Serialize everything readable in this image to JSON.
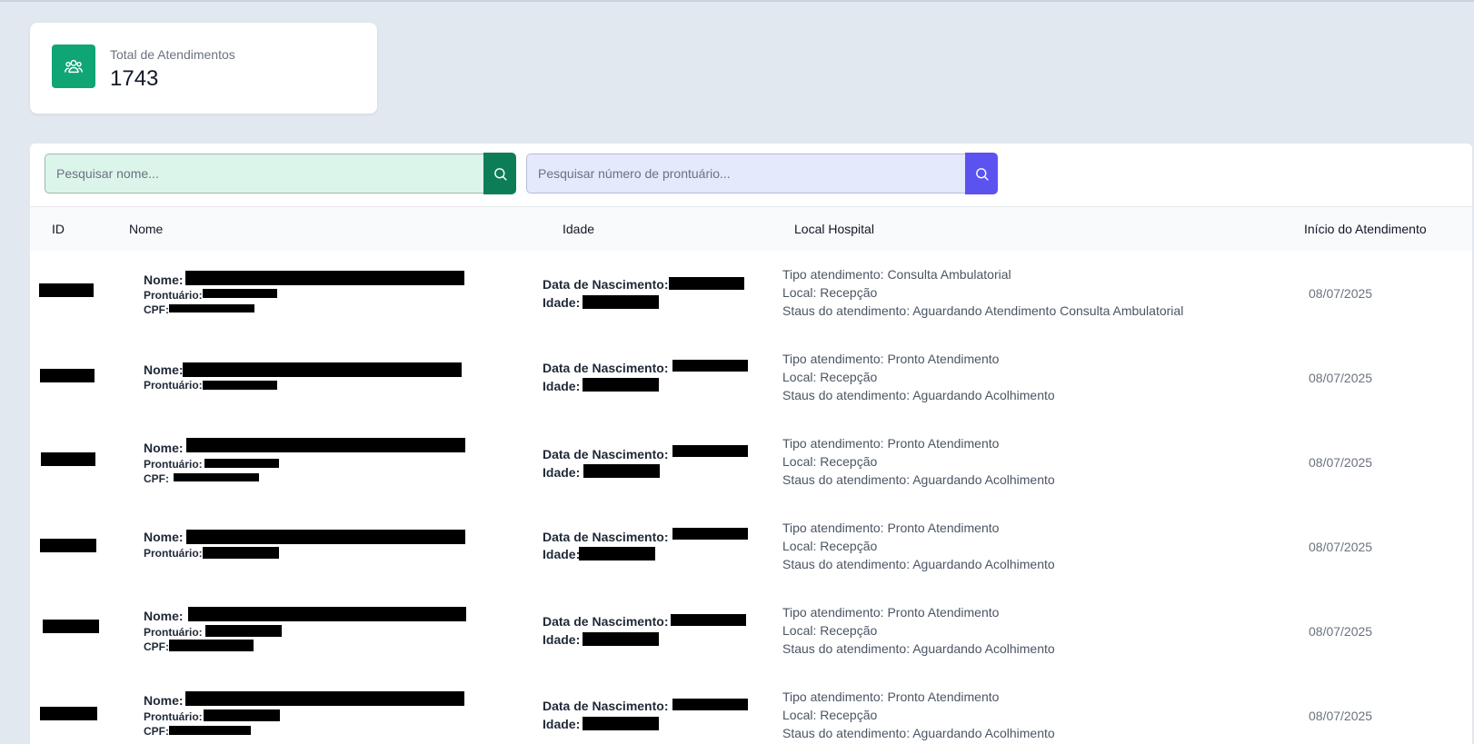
{
  "stats": {
    "label": "Total de Atendimentos",
    "value": "1743",
    "icon": "users-icon",
    "icon_bg": "#10a574"
  },
  "search": {
    "name_placeholder": "Pesquisar nome...",
    "prontuario_placeholder": "Pesquisar número de prontuário..."
  },
  "table": {
    "headers": {
      "id": "ID",
      "nome": "Nome",
      "idade": "Idade",
      "local": "Local Hospital",
      "inicio": "Início do Atendimento"
    },
    "field_labels": {
      "nome": "Nome:",
      "prontuario": "Prontuário:",
      "cpf": "CPF:",
      "nascimento": "Data de Nascimento:",
      "idade": "Idade:"
    },
    "rows": [
      {
        "tipo": "Tipo atendimento: Consulta Ambulatorial",
        "local": "Local: Recepção",
        "status": "Staus do atendimento: Aguardando Atendimento Consulta Ambulatorial",
        "data": "08/07/2025"
      },
      {
        "tipo": "Tipo atendimento: Pronto Atendimento",
        "local": "Local: Recepção",
        "status": "Staus do atendimento: Aguardando Acolhimento",
        "data": "08/07/2025"
      },
      {
        "tipo": "Tipo atendimento: Pronto Atendimento",
        "local": "Local: Recepção",
        "status": "Staus do atendimento: Aguardando Acolhimento",
        "data": "08/07/2025"
      },
      {
        "tipo": "Tipo atendimento: Pronto Atendimento",
        "local": "Local: Recepção",
        "status": "Staus do atendimento: Aguardando Acolhimento",
        "data": "08/07/2025"
      },
      {
        "tipo": "Tipo atendimento: Pronto Atendimento",
        "local": "Local: Recepção",
        "status": "Staus do atendimento: Aguardando Acolhimento",
        "data": "08/07/2025"
      },
      {
        "tipo": "Tipo atendimento: Pronto Atendimento",
        "local": "Local: Recepção",
        "status": "Staus do atendimento: Aguardando Acolhimento",
        "data": "08/07/2025"
      }
    ]
  },
  "colors": {
    "background": "#e2e8f0",
    "name_search_bg": "#dcf5ea",
    "name_search_button": "#0d7d57",
    "prontuario_search_bg": "#e4e9fb",
    "prontuario_search_button": "#5b52f0"
  }
}
